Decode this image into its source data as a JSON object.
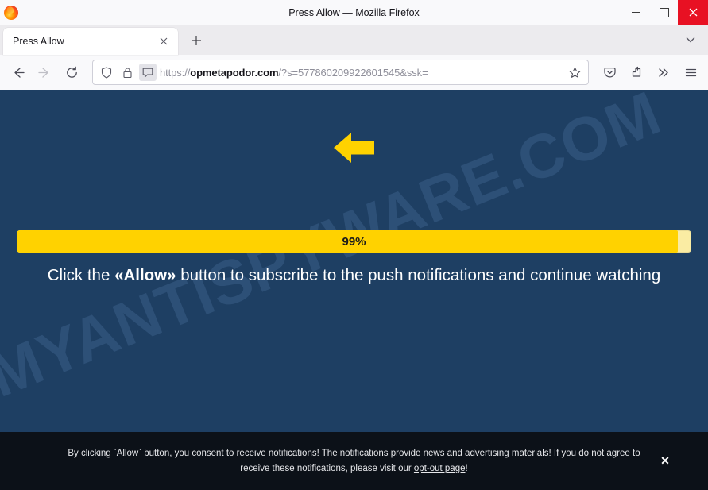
{
  "window": {
    "title": "Press Allow — Mozilla Firefox",
    "logo_icon": "firefox-logo-icon",
    "minimize_label": "Minimize",
    "maximize_label": "Maximize",
    "close_label": "Close"
  },
  "tabstrip": {
    "tabs": [
      {
        "title": "Press Allow",
        "close_label": "Close tab"
      }
    ],
    "new_tab_label": "+",
    "tab_list_icon": "chevron-down-icon"
  },
  "navbar": {
    "back_icon": "back-arrow-icon",
    "forward_icon": "forward-arrow-icon",
    "reload_icon": "reload-icon",
    "shield_icon": "shield-icon",
    "lock_icon": "lock-icon",
    "permission_icon": "notification-permission-icon",
    "bookmark_icon": "star-icon",
    "pocket_icon": "pocket-icon",
    "share_icon": "share-icon",
    "overflow_icon": "double-chevron-icon",
    "menu_icon": "hamburger-menu-icon",
    "url": {
      "scheme": "https://",
      "host": "opmetapodor.com",
      "path": "/?s=577860209922601545&ssk=",
      "full": "https://opmetapodor.com/?s=577860209922601545&ssk="
    }
  },
  "page": {
    "background_color": "#1e3f63",
    "watermark": "MYANTISPYWARE.COM",
    "arrow_icon": "left-arrow-icon",
    "arrow_color": "#ffd200",
    "progress": {
      "percent_label": "99%",
      "percent_value": 99,
      "fill_color": "#ffd200",
      "track_color": "#faeca3"
    },
    "headline_prefix": "Click the ",
    "headline_emphasis": "«Allow»",
    "headline_suffix": " button to subscribe to the push notifications and continue watching"
  },
  "consent_banner": {
    "background_color": "#0c1118",
    "text_part1": "By clicking `Allow` button, you consent to receive notifications! The notifications provide news and advertising materials! If you do not agree to receive these notifications, please visit our ",
    "link_text": "opt-out page",
    "text_part2": "!",
    "close_label": "✕"
  }
}
